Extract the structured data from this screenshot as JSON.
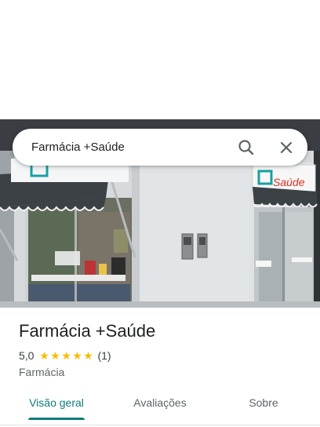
{
  "search": {
    "query": "Farmácia +Saúde"
  },
  "photo": {
    "sign_brand": "Saúde"
  },
  "place": {
    "name": "Farmácia +Saúde",
    "rating": "5,0",
    "stars": 5,
    "review_count": "(1)",
    "category": "Farmácia"
  },
  "tabs": [
    {
      "label": "Visão geral",
      "active": true
    },
    {
      "label": "Avaliações",
      "active": false
    },
    {
      "label": "Sobre",
      "active": false
    }
  ],
  "colors": {
    "accent": "#0f7b7b",
    "star": "#fbbc04",
    "sign_red": "#d93025",
    "sign_teal": "#1aa0a0"
  },
  "icons": {
    "search": "search-icon",
    "close": "close-icon",
    "star": "star-icon"
  }
}
